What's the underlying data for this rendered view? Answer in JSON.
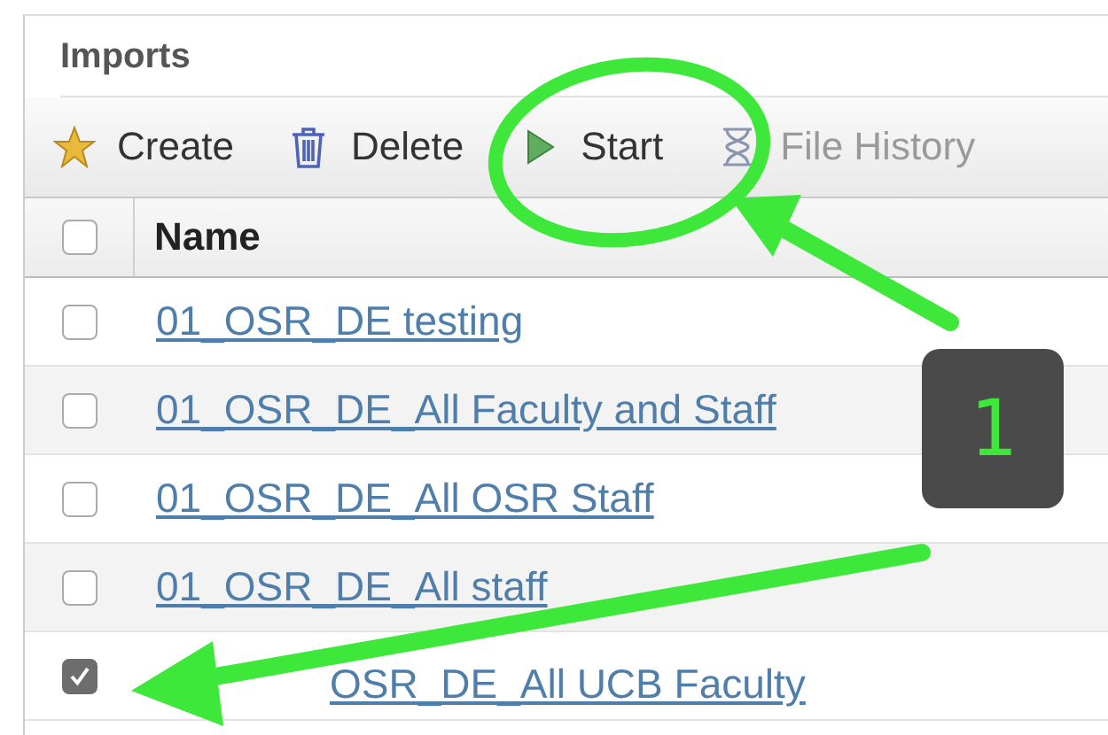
{
  "panel": {
    "title": "Imports"
  },
  "toolbar": [
    {
      "kind": "create",
      "label": "Create",
      "disabled": false
    },
    {
      "kind": "delete",
      "label": "Delete",
      "disabled": false
    },
    {
      "kind": "start",
      "label": "Start",
      "disabled": false
    },
    {
      "kind": "history",
      "label": "File History",
      "disabled": true
    }
  ],
  "table": {
    "columns": [
      "Name"
    ],
    "header_checked": false,
    "rows": [
      {
        "name": "01_OSR_DE testing",
        "checked": false
      },
      {
        "name": "01_OSR_DE_All Faculty and Staff",
        "checked": false
      },
      {
        "name": "01_OSR_DE_All OSR Staff",
        "checked": false
      },
      {
        "name": "01_OSR_DE_All staff",
        "checked": false
      },
      {
        "name": "OSR_DE_All UCB Faculty",
        "checked": true
      }
    ]
  },
  "annotation": {
    "badge": "1"
  }
}
